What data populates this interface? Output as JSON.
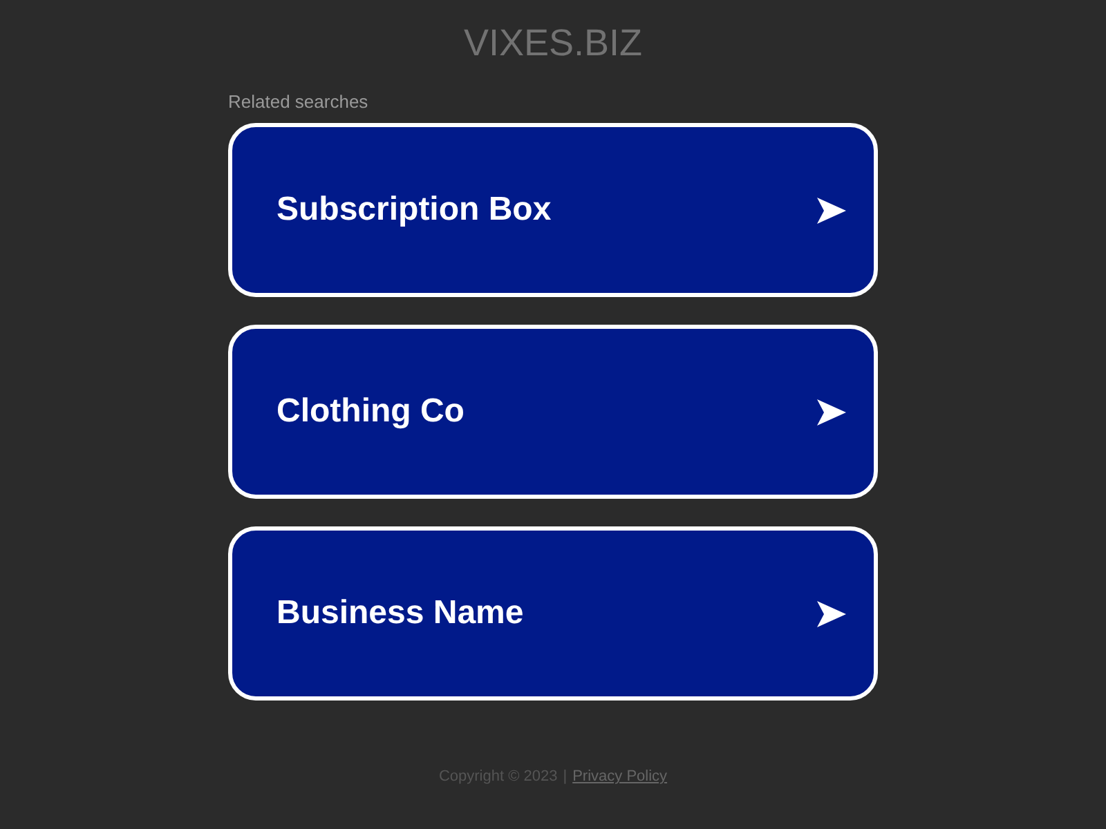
{
  "site_title": "VIXES.BIZ",
  "related_label": "Related searches",
  "searches": [
    {
      "label": "Subscription Box"
    },
    {
      "label": "Clothing Co"
    },
    {
      "label": "Business Name"
    }
  ],
  "footer": {
    "copyright": "Copyright © 2023",
    "separator": "|",
    "privacy_link": "Privacy Policy"
  }
}
